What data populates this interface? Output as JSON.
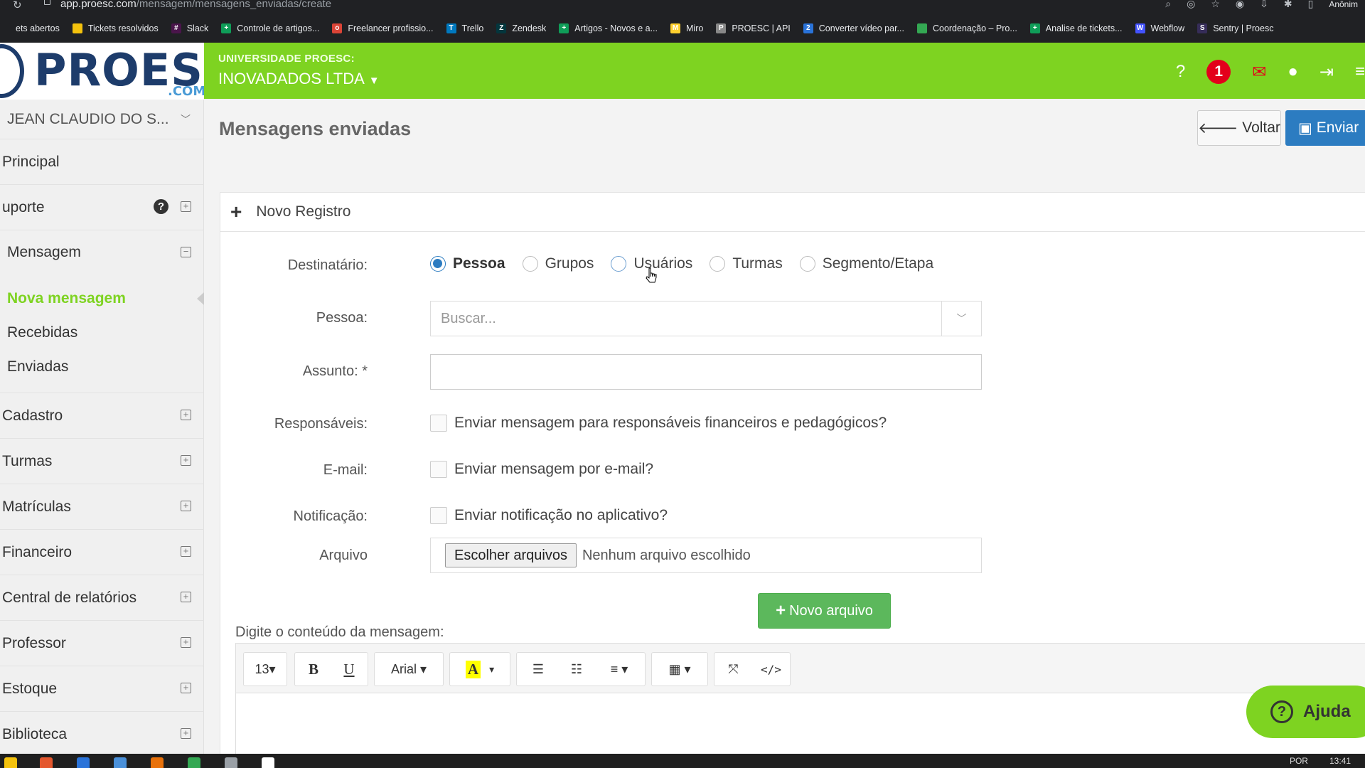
{
  "browser": {
    "url_host": "app.proesc.com",
    "url_path": "/mensagem/mensagens_enviadas/create",
    "profile": "Anônim",
    "bookmarks": [
      {
        "label": "ets abertos",
        "color": "#202124",
        "glyph": ""
      },
      {
        "label": "Tickets resolvidos",
        "color": "#f4c20d",
        "glyph": ""
      },
      {
        "label": "Slack",
        "color": "#4a154b",
        "glyph": "#"
      },
      {
        "label": "Controle de artigos...",
        "color": "#0f9d58",
        "glyph": "+"
      },
      {
        "label": "Freelancer profissio...",
        "color": "#db4437",
        "glyph": "o"
      },
      {
        "label": "Trello",
        "color": "#0079bf",
        "glyph": "T"
      },
      {
        "label": "Zendesk",
        "color": "#03363d",
        "glyph": "Z"
      },
      {
        "label": "Artigos - Novos e a...",
        "color": "#0f9d58",
        "glyph": "+"
      },
      {
        "label": "Miro",
        "color": "#ffd02f",
        "glyph": "M"
      },
      {
        "label": "PROESC | API",
        "color": "#888888",
        "glyph": "P"
      },
      {
        "label": "Converter vídeo par...",
        "color": "#2a73d9",
        "glyph": "2"
      },
      {
        "label": "Coordenação – Pro...",
        "color": "#34a853",
        "glyph": ""
      },
      {
        "label": "Analise de tickets...",
        "color": "#0f9d58",
        "glyph": "+"
      },
      {
        "label": "Webflow",
        "color": "#4353ff",
        "glyph": "W"
      },
      {
        "label": "Sentry | Proesc",
        "color": "#362d59",
        "glyph": "S"
      }
    ]
  },
  "brand": {
    "logo_text": "PROESC",
    "logo_suffix": ".COM",
    "accent": "#7ed321",
    "dark": "#1d3c6b"
  },
  "header": {
    "university_label": "UNIVERSIDADE PROESC:",
    "company_name": "INOVADADOS LTDA",
    "notification_count": "1"
  },
  "sidebar": {
    "user_name": "JEAN CLAUDIO DO S...",
    "items": [
      {
        "label": "Principal"
      },
      {
        "label": "uporte"
      },
      {
        "label": "Mensagem"
      },
      {
        "label": "Cadastro"
      },
      {
        "label": "Turmas"
      },
      {
        "label": "Matrículas"
      },
      {
        "label": "Financeiro"
      },
      {
        "label": "Central de relatórios"
      },
      {
        "label": "Professor"
      },
      {
        "label": "Estoque"
      },
      {
        "label": "Biblioteca"
      }
    ],
    "mensagem_sub": [
      {
        "label": "Nova mensagem"
      },
      {
        "label": "Recebidas"
      },
      {
        "label": "Enviadas"
      }
    ]
  },
  "page": {
    "title": "Mensagens enviadas",
    "back_label": "Voltar",
    "send_label": "Enviar",
    "panel_title": "Novo Registro"
  },
  "form": {
    "recipient_label": "Destinatário:",
    "recipient_options": [
      "Pessoa",
      "Grupos",
      "Usuários",
      "Turmas",
      "Segmento/Etapa"
    ],
    "recipient_selected": "Pessoa",
    "person_label": "Pessoa:",
    "person_placeholder": "Buscar...",
    "subject_label": "Assunto: *",
    "responsible_label": "Responsáveis:",
    "responsible_text": "Enviar mensagem para responsáveis financeiros e pedagógicos?",
    "email_label": "E-mail:",
    "email_text": "Enviar mensagem por e-mail?",
    "notification_label": "Notificação:",
    "notification_text": "Enviar notificação no aplicativo?",
    "file_label": "Arquivo",
    "file_button": "Escolher arquivos",
    "file_status": "Nenhum arquivo escolhido",
    "new_file_button": "Novo arquivo",
    "editor_label": "Digite o conteúdo da mensagem:"
  },
  "editor": {
    "font_size": "13",
    "font_family": "Arial"
  },
  "help_button": "Ajuda",
  "taskbar": {
    "lang": "POR",
    "time": "13:41"
  }
}
